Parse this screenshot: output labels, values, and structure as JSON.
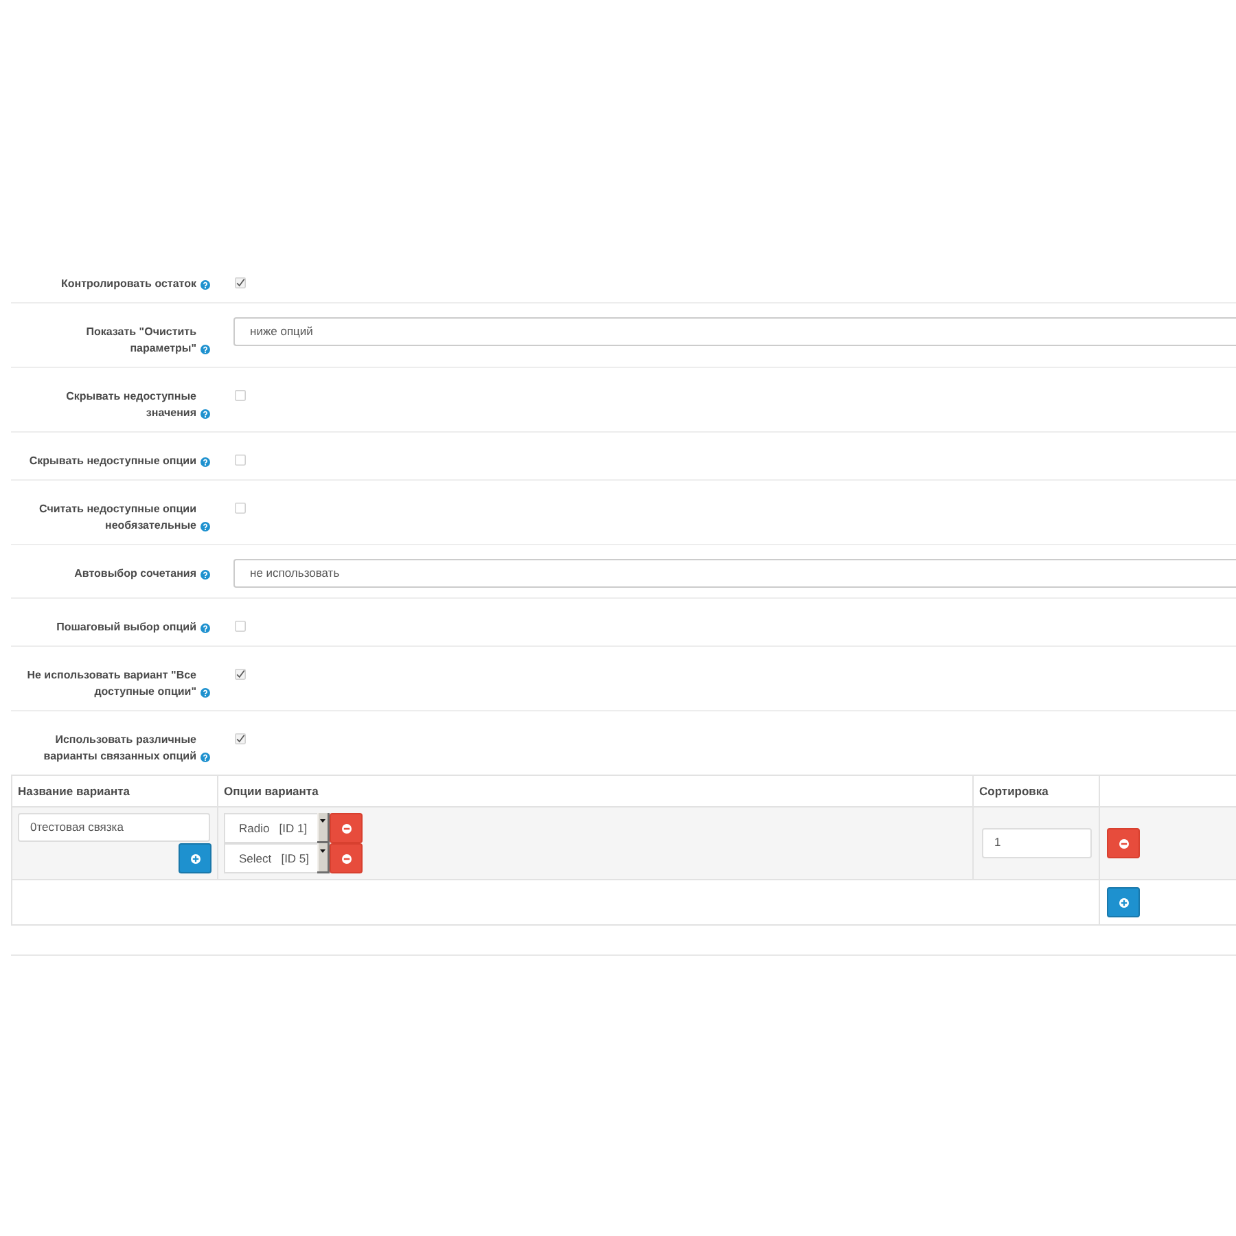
{
  "settings": [
    {
      "kind": "checkbox",
      "label": "Контролировать остаток",
      "checked": true
    },
    {
      "kind": "select",
      "label": "Показать \"Очистить параметры\"",
      "value": "ниже опций"
    },
    {
      "kind": "checkbox",
      "label": "Скрывать недоступные значения",
      "checked": false
    },
    {
      "kind": "checkbox",
      "label": "Скрывать недоступные опции",
      "checked": false
    },
    {
      "kind": "checkbox",
      "label": "Считать недоступные опции необязательные",
      "checked": false
    },
    {
      "kind": "select",
      "label": "Автовыбор сочетания",
      "value": "не использовать"
    },
    {
      "kind": "checkbox",
      "label": "Пошаговый выбор опций",
      "checked": false
    },
    {
      "kind": "checkbox",
      "label": "Не использовать вариант \"Все доступные опции\"",
      "checked": true
    },
    {
      "kind": "checkbox",
      "label": "Использовать различные варианты связанных опций",
      "checked": true
    }
  ],
  "variants_table": {
    "columns": [
      "Название варианта",
      "Опции варианта",
      "Сортировка"
    ],
    "rows": [
      {
        "name": "0тестовая связка",
        "options": [
          "Radio   [ID 1]",
          "Select   [ID 5]"
        ],
        "sort": "1"
      }
    ]
  }
}
